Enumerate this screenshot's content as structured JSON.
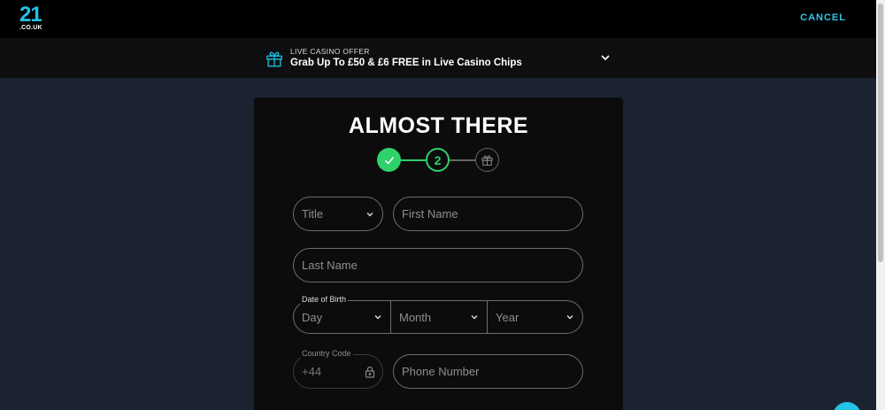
{
  "topbar": {
    "logo_number": "21",
    "logo_suffix": ".CO.UK",
    "cancel_label": "CANCEL"
  },
  "offer": {
    "label": "LIVE CASINO OFFER",
    "title": "Grab Up To £50 & £6 FREE in Live Casino Chips",
    "icon": "gift-icon"
  },
  "form": {
    "heading": "ALMOST THERE",
    "steps": {
      "step1_state": "completed",
      "step2_label": "2",
      "step3_icon": "gift-icon"
    },
    "title_placeholder": "Title",
    "first_name_placeholder": "First Name",
    "last_name_placeholder": "Last Name",
    "dob_label": "Date of Birth",
    "dob_day_placeholder": "Day",
    "dob_month_placeholder": "Month",
    "dob_year_placeholder": "Year",
    "country_code_label": "Country Code",
    "country_code_value": "+44",
    "phone_placeholder": "Phone Number"
  },
  "colors": {
    "accent": "#1fc4e8",
    "success": "#2fd16a",
    "background": "#1b2330",
    "card": "#0c0c0d"
  }
}
